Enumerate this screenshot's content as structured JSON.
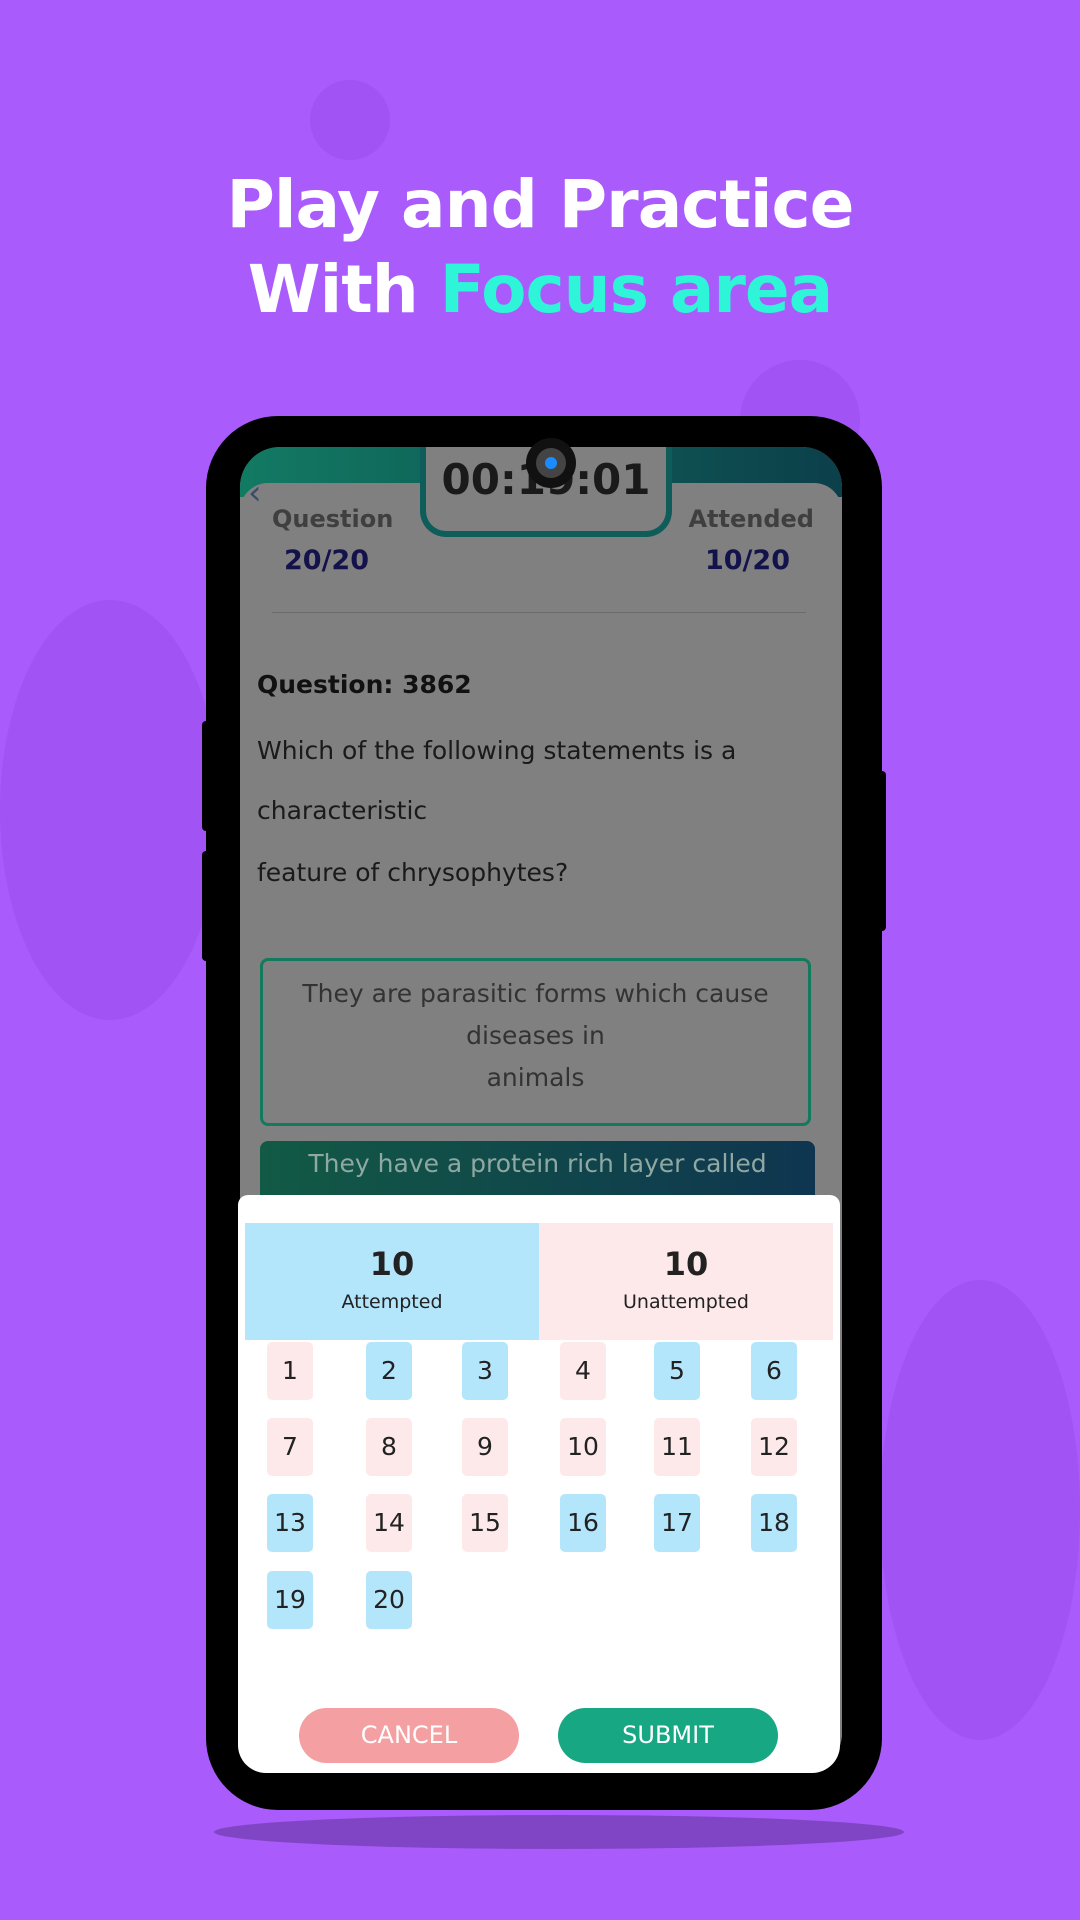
{
  "headline": {
    "line1": "Play and Practice",
    "line2_prefix": "With ",
    "line2_accent": "Focus area"
  },
  "colors": {
    "background": "#a95bfb",
    "accent": "#2ff5d8",
    "attempted": "#b3e5fb",
    "unattempted": "#fde9e9",
    "cancel": "#f4a0a2",
    "submit": "#17a883"
  },
  "header": {
    "timer": "00:19:01",
    "question_label": "Question",
    "question_value": "20/20",
    "attended_label": "Attended",
    "attended_value": "10/20",
    "back_icon": "chevron-left-icon"
  },
  "question": {
    "title": "Question: 3862",
    "lines": [
      "Which of the following statements is a",
      "characteristic",
      "feature of chrysophytes?"
    ],
    "options": [
      {
        "lines": [
          "They are parasitic forms which cause",
          "diseases in",
          "animals"
        ]
      },
      {
        "lines": [
          "They have a protein rich layer called"
        ]
      }
    ]
  },
  "summary": {
    "attempted": {
      "count": "10",
      "label": "Attempted"
    },
    "unattempted": {
      "count": "10",
      "label": "Unattempted"
    }
  },
  "grid": [
    {
      "n": "1",
      "s": "un"
    },
    {
      "n": "2",
      "s": "att"
    },
    {
      "n": "3",
      "s": "att"
    },
    {
      "n": "4",
      "s": "un"
    },
    {
      "n": "5",
      "s": "att"
    },
    {
      "n": "6",
      "s": "att"
    },
    {
      "n": "7",
      "s": "un"
    },
    {
      "n": "8",
      "s": "un"
    },
    {
      "n": "9",
      "s": "un"
    },
    {
      "n": "10",
      "s": "un"
    },
    {
      "n": "11",
      "s": "un"
    },
    {
      "n": "12",
      "s": "un"
    },
    {
      "n": "13",
      "s": "att"
    },
    {
      "n": "14",
      "s": "un"
    },
    {
      "n": "15",
      "s": "un"
    },
    {
      "n": "16",
      "s": "att"
    },
    {
      "n": "17",
      "s": "att"
    },
    {
      "n": "18",
      "s": "att"
    },
    {
      "n": "19",
      "s": "att"
    },
    {
      "n": "20",
      "s": "att"
    }
  ],
  "buttons": {
    "cancel": "CANCEL",
    "submit": "SUBMIT"
  }
}
